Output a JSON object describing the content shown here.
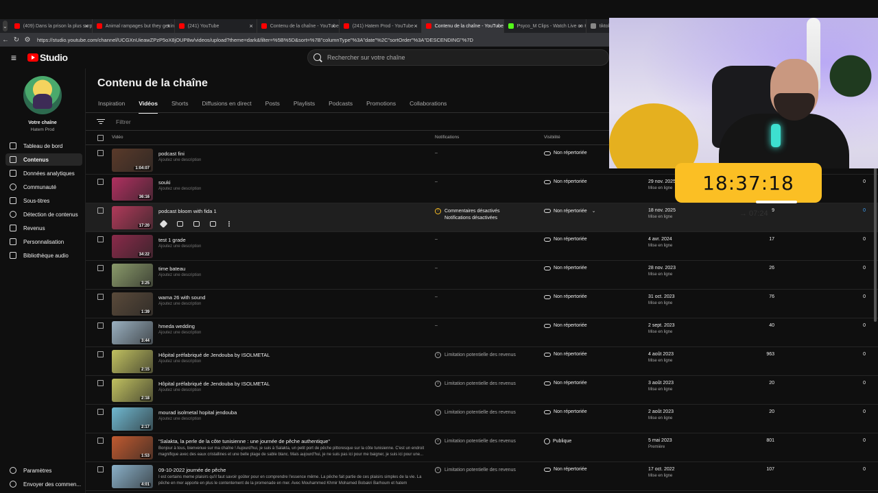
{
  "browser": {
    "tabs": [
      {
        "label": "(409) Dans la prison la plus surpe",
        "color": "#ff0000",
        "active": false
      },
      {
        "label": "Animal rampages but they get in",
        "color": "#ff0000",
        "active": false
      },
      {
        "label": "(241) YouTube",
        "color": "#ff0000",
        "active": false
      },
      {
        "label": "Contenu de la chaîne - YouTube St",
        "color": "#ff0000",
        "active": false
      },
      {
        "label": "(241) Hatem Prod - YouTube",
        "color": "#ff0000",
        "active": false
      },
      {
        "label": "Contenu de la chaîne - YouTube St",
        "color": "#ff0000",
        "active": true
      },
      {
        "label": "Psyco_M Clips - Watch Live on Ki",
        "color": "#53fc18",
        "active": false
      },
      {
        "label": "tiktok",
        "color": "#888888",
        "active": false
      }
    ],
    "url": "https://studio.youtube.com/channel/UCGXnUieawZPzP5oX8jOUP8w/videos/upload?theme=dark&filter=%5B%5D&sort=%7B\"columnType\"%3A\"date\"%2C\"sortOrder\"%3A\"DESCENDING\"%7D"
  },
  "header": {
    "logo_text": "Studio",
    "search_placeholder": "Rechercher sur votre chaîne"
  },
  "sidebar": {
    "channel_label": "Votre chaîne",
    "channel_name": "Hatem Prod",
    "items": [
      {
        "label": "Tableau de bord",
        "icon": "dashboard-icon",
        "active": false
      },
      {
        "label": "Contenus",
        "icon": "content-icon",
        "active": true
      },
      {
        "label": "Données analytiques",
        "icon": "analytics-icon",
        "active": false
      },
      {
        "label": "Communauté",
        "icon": "community-icon",
        "active": false
      },
      {
        "label": "Sous-titres",
        "icon": "subtitles-icon",
        "active": false
      },
      {
        "label": "Détection de contenus",
        "icon": "detection-icon",
        "active": false
      },
      {
        "label": "Revenus",
        "icon": "revenue-icon",
        "active": false
      },
      {
        "label": "Personnalisation",
        "icon": "customization-icon",
        "active": false
      },
      {
        "label": "Bibliothèque audio",
        "icon": "audio-library-icon",
        "active": false
      }
    ],
    "bottom_items": [
      {
        "label": "Paramètres",
        "icon": "settings-icon"
      },
      {
        "label": "Envoyer des commen...",
        "icon": "feedback-icon"
      }
    ]
  },
  "main": {
    "title": "Contenu de la chaîne",
    "tabs": [
      "Inspiration",
      "Vidéos",
      "Shorts",
      "Diffusions en direct",
      "Posts",
      "Playlists",
      "Podcasts",
      "Promotions",
      "Collaborations"
    ],
    "active_tab": "Vidéos",
    "filter_placeholder": "Filtrer",
    "columns": {
      "video": "Vidéo",
      "notifications": "Notifications",
      "visibility": "Visibilité"
    },
    "rows": [
      {
        "title": "podcast fini",
        "desc": "Ajoutez une description",
        "duration": "1:04:07",
        "notif": "–",
        "visibility": "Non répertoriée",
        "date": "",
        "date_sub": "",
        "views": "",
        "comments": "",
        "thumb": "#5a3a2a"
      },
      {
        "title": "souki",
        "desc": "Ajoutez une description",
        "duration": "36:16",
        "notif": "–",
        "visibility": "Non répertoriée",
        "date": "29 nov. 2025",
        "date_sub": "Mise en ligne",
        "views": "",
        "comments": "0",
        "thumb": "#b03060"
      },
      {
        "title": "podcast bloom with fida 1",
        "desc": "",
        "duration": "17:20",
        "notif": "",
        "visibility": "Non répertoriée",
        "date": "18 nov. 2025",
        "date_sub": "Mise en ligne",
        "views": "9",
        "comments": "0",
        "thumb": "#b03a5a"
      },
      {
        "title": "test 1 grade",
        "desc": "Ajoutez une description",
        "duration": "34:22",
        "notif": "–",
        "visibility": "Non répertoriée",
        "date": "4 avr. 2024",
        "date_sub": "Mise en ligne",
        "views": "17",
        "comments": "0",
        "thumb": "#8a2a4a"
      },
      {
        "title": "time bateau",
        "desc": "Ajoutez une description",
        "duration": "3:25",
        "notif": "–",
        "visibility": "Non répertoriée",
        "date": "28 nov. 2023",
        "date_sub": "Mise en ligne",
        "views": "26",
        "comments": "0",
        "thumb": "#8a9a6a"
      },
      {
        "title": "wama 26 with sound",
        "desc": "Ajoutez une description",
        "duration": "1:39",
        "notif": "–",
        "visibility": "Non répertoriée",
        "date": "31 oct. 2023",
        "date_sub": "Mise en ligne",
        "views": "76",
        "comments": "0",
        "thumb": "#5a4a3a"
      },
      {
        "title": "hmeda wedding",
        "desc": "Ajoutez une description",
        "duration": "3:44",
        "notif": "–",
        "visibility": "Non répertoriée",
        "date": "2 sept. 2023",
        "date_sub": "Mise en ligne",
        "views": "40",
        "comments": "0",
        "thumb": "#9ab0c0"
      },
      {
        "title": "Hôpital préfabriqué de Jendouba by ISOLMETAL",
        "desc": "Ajoutez une description",
        "duration": "2:15",
        "notif": "Limitation potentielle des revenus",
        "visibility": "Non répertoriée",
        "date": "4 août 2023",
        "date_sub": "Mise en ligne",
        "views": "963",
        "comments": "0",
        "thumb": "#c0c060"
      },
      {
        "title": "Hôpital préfabriqué de Jendouba by ISOLMETAL",
        "desc": "Ajoutez une description",
        "duration": "2:18",
        "notif": "Limitation potentielle des revenus",
        "visibility": "Non répertoriée",
        "date": "3 août 2023",
        "date_sub": "Mise en ligne",
        "views": "20",
        "comments": "0",
        "thumb": "#c0c060"
      },
      {
        "title": "mourad isolmetal hopital jendouba",
        "desc": "Ajoutez une description",
        "duration": "2:17",
        "notif": "Limitation potentielle des revenus",
        "visibility": "Non répertoriée",
        "date": "2 août 2023",
        "date_sub": "Mise en ligne",
        "views": "20",
        "comments": "0",
        "thumb": "#70b8d0"
      },
      {
        "title": "\"Salakta, la perle de la côte tunisienne : une journée de pêche authentique\"",
        "desc": "Bonjour à tous, bienvenue sur ma chaîne ! Aujourd'hui, je suis à Salakta, un petit port de pêche pittoresque sur la côte tunisienne. C'est un endroit magnifique avec des eaux cristallines et une belle plage de sable blanc. Mais aujourd'hui, je ne suis pas ici pour me baigner, je suis ici pour une...",
        "duration": "1:53",
        "notif": "Limitation potentielle des revenus",
        "visibility": "Publique",
        "date": "5 mai 2023",
        "date_sub": "Première",
        "views": "801",
        "comments": "0",
        "thumb": "#c05a30"
      },
      {
        "title": "09-10-2022 journée de pêche",
        "desc": "I est certains meme plaisirs qu'il faut savoir goûter pour en comprendre l'essence même. La pêche fait partie de ces plaisirs simples de la vie. La pêche en mer apporte en plus le contentement de la promenade en mer. Avec Mouhammed Khmir Mohamed Bobakri Barhoum et hatem",
        "duration": "4:01",
        "notif": "Limitation potentielle des revenus",
        "visibility": "Non répertoriée",
        "date": "17 oct. 2022",
        "date_sub": "Mise en ligne",
        "views": "107",
        "comments": "0",
        "thumb": "#8ab0c8"
      }
    ],
    "hover_row": {
      "notif_line1": "Commentaires désactivés",
      "notif_line2": "Notifications désactivées"
    }
  },
  "overlay": {
    "clock": "18:37:18",
    "clock_ghost": "→ 07:24"
  }
}
